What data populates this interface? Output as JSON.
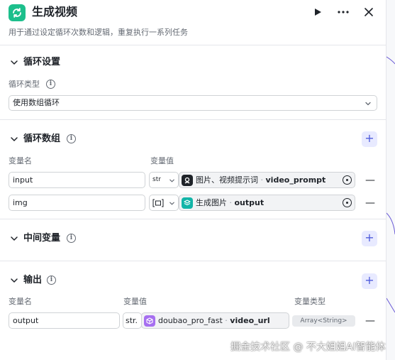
{
  "header": {
    "title": "生成视频",
    "description": "用于通过设定循环次数和逻辑，重复执行一系列任务"
  },
  "loop_settings": {
    "title": "循环设置",
    "type_label": "循环类型",
    "type_value": "使用数组循环"
  },
  "loop_array": {
    "title": "循环数组",
    "col_name": "变量名",
    "col_value": "变量值",
    "rows": [
      {
        "name": "input",
        "type": "str",
        "source": "图片、视频提示词",
        "sep": " · ",
        "variable": "video_prompt"
      },
      {
        "name": "img",
        "type": "[□]",
        "source": "生成图片",
        "sep": " · ",
        "variable": "output"
      }
    ]
  },
  "intermediate": {
    "title": "中间变量"
  },
  "output": {
    "title": "输出",
    "col_name": "变量名",
    "col_value": "变量值",
    "col_type": "变量类型",
    "row": {
      "name": "output",
      "type": "str.",
      "source": "doubao_pro_fast",
      "sep": " · ",
      "variable": "video_url",
      "var_type": "Array<String>"
    }
  },
  "watermark": "掘金技术社区 @ 不大姐姐AI智能体",
  "colors": {
    "app_icon": "#1dbf8c",
    "accent": "#4e5bdb",
    "add_bg": "#e8eaff",
    "ref_icon_black": "#1f2329",
    "ref_icon_teal": "#13b5a8",
    "ref_icon_purple": "#a66ff0"
  }
}
